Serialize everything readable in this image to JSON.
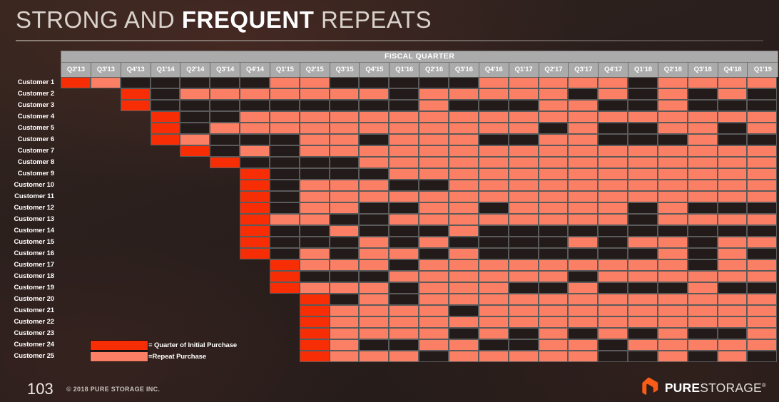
{
  "slide": {
    "title_part1": "STRONG AND ",
    "title_strong": "FREQUENT",
    "title_part2": " REPEATS",
    "page_number": "103",
    "copyright": "© 2018 PURE STORAGE INC.",
    "logo_name_bold": "PURE",
    "logo_name_light": "STORAGE",
    "logo_registered": "®"
  },
  "legend": {
    "items": [
      {
        "swatch": "initial",
        "label": "= Quarter of Initial Purchase",
        "color": "#F72D06"
      },
      {
        "swatch": "repeat",
        "label": "=Repeat Purchase",
        "color": "#FA7F65"
      }
    ]
  },
  "colors": {
    "initial_purchase": "#F72D06",
    "repeat_purchase": "#FA7F65",
    "no_purchase": "#231B19",
    "grid_line": "#5A5A5A",
    "header_band": "#ABABAB",
    "background": "#2B201E",
    "title_text": "#D9D2CC"
  },
  "chart_data": {
    "type": "heatmap",
    "title": "STRONG AND FREQUENT REPEATS",
    "xlabel": "FISCAL QUARTER",
    "ylabel": "",
    "axis_band_label": "FISCAL QUARTER",
    "legend_position": "bottom-left",
    "grid": true,
    "value_legend": {
      "0": "No purchase",
      "1": "Repeat Purchase",
      "2": "Quarter of Initial Purchase",
      "null": "Before customer acquisition"
    },
    "categories": [
      "Q2'13",
      "Q3'13",
      "Q4'13",
      "Q1'14",
      "Q2'14",
      "Q3'14",
      "Q4'14",
      "Q1'15",
      "Q2'15",
      "Q3'15",
      "Q4'15",
      "Q1'16",
      "Q2'16",
      "Q3'16",
      "Q4'16",
      "Q1'17",
      "Q2'17",
      "Q3'17",
      "Q4'17",
      "Q1'18",
      "Q2'18",
      "Q3'18",
      "Q4'18",
      "Q1'19"
    ],
    "rows": [
      "Customer 1",
      "Customer 2",
      "Customer 3",
      "Customer 4",
      "Customer 5",
      "Customer 6",
      "Customer 7",
      "Customer 8",
      "Customer 9",
      "Customer 10",
      "Customer 11",
      "Customer 12",
      "Customer 13",
      "Customer 14",
      "Customer 15",
      "Customer 16",
      "Customer 17",
      "Customer 18",
      "Customer 19",
      "Customer 20",
      "Customer 21",
      "Customer 22",
      "Customer 23",
      "Customer 24",
      "Customer 25"
    ],
    "series": [
      {
        "name": "Customer 1",
        "values": [
          2,
          1,
          0,
          0,
          0,
          0,
          0,
          1,
          1,
          0,
          0,
          0,
          0,
          0,
          1,
          1,
          1,
          1,
          1,
          0,
          1,
          1,
          1,
          1
        ]
      },
      {
        "name": "Customer 2",
        "values": [
          null,
          null,
          2,
          0,
          1,
          1,
          1,
          1,
          1,
          1,
          1,
          0,
          1,
          1,
          1,
          1,
          1,
          0,
          1,
          0,
          1,
          0,
          1,
          0
        ]
      },
      {
        "name": "Customer 3",
        "values": [
          null,
          null,
          2,
          0,
          0,
          0,
          0,
          0,
          0,
          0,
          0,
          0,
          1,
          0,
          0,
          0,
          1,
          1,
          0,
          0,
          1,
          0,
          0,
          0
        ]
      },
      {
        "name": "Customer 4",
        "values": [
          null,
          null,
          null,
          2,
          0,
          0,
          1,
          1,
          1,
          1,
          1,
          1,
          1,
          1,
          1,
          1,
          1,
          1,
          1,
          1,
          1,
          1,
          1,
          1
        ]
      },
      {
        "name": "Customer 5",
        "values": [
          null,
          null,
          null,
          2,
          0,
          1,
          1,
          1,
          1,
          1,
          1,
          1,
          1,
          1,
          1,
          1,
          0,
          1,
          0,
          0,
          1,
          1,
          0,
          1
        ]
      },
      {
        "name": "Customer 6",
        "values": [
          null,
          null,
          null,
          2,
          1,
          0,
          0,
          0,
          1,
          1,
          0,
          1,
          1,
          1,
          0,
          0,
          1,
          1,
          0,
          0,
          0,
          1,
          0,
          0
        ]
      },
      {
        "name": "Customer 7",
        "values": [
          null,
          null,
          null,
          null,
          2,
          0,
          1,
          0,
          1,
          1,
          1,
          1,
          1,
          1,
          1,
          1,
          1,
          1,
          1,
          1,
          1,
          1,
          1,
          1
        ]
      },
      {
        "name": "Customer 8",
        "values": [
          null,
          null,
          null,
          null,
          null,
          2,
          0,
          0,
          0,
          0,
          1,
          1,
          1,
          1,
          1,
          1,
          1,
          1,
          1,
          1,
          1,
          1,
          1,
          1
        ]
      },
      {
        "name": "Customer 9",
        "values": [
          null,
          null,
          null,
          null,
          null,
          null,
          2,
          0,
          0,
          0,
          0,
          1,
          1,
          1,
          1,
          1,
          1,
          1,
          1,
          1,
          1,
          1,
          1,
          1
        ]
      },
      {
        "name": "Customer 10",
        "values": [
          null,
          null,
          null,
          null,
          null,
          null,
          2,
          0,
          1,
          1,
          1,
          0,
          0,
          1,
          1,
          1,
          1,
          1,
          1,
          1,
          1,
          1,
          1,
          1
        ]
      },
      {
        "name": "Customer 11",
        "values": [
          null,
          null,
          null,
          null,
          null,
          null,
          2,
          0,
          1,
          1,
          1,
          1,
          1,
          1,
          1,
          1,
          1,
          1,
          1,
          1,
          1,
          1,
          1,
          1
        ]
      },
      {
        "name": "Customer 12",
        "values": [
          null,
          null,
          null,
          null,
          null,
          null,
          2,
          0,
          1,
          1,
          0,
          0,
          1,
          1,
          0,
          1,
          1,
          1,
          1,
          0,
          1,
          0,
          0,
          0
        ]
      },
      {
        "name": "Customer 13",
        "values": [
          null,
          null,
          null,
          null,
          null,
          null,
          2,
          1,
          1,
          0,
          0,
          1,
          1,
          1,
          1,
          1,
          1,
          1,
          1,
          0,
          1,
          1,
          1,
          1
        ]
      },
      {
        "name": "Customer 14",
        "values": [
          null,
          null,
          null,
          null,
          null,
          null,
          2,
          0,
          0,
          1,
          0,
          0,
          0,
          1,
          0,
          0,
          0,
          0,
          0,
          0,
          0,
          0,
          0,
          0
        ]
      },
      {
        "name": "Customer 15",
        "values": [
          null,
          null,
          null,
          null,
          null,
          null,
          2,
          0,
          0,
          0,
          1,
          0,
          1,
          0,
          0,
          0,
          0,
          1,
          0,
          1,
          1,
          0,
          1,
          1
        ]
      },
      {
        "name": "Customer 16",
        "values": [
          null,
          null,
          null,
          null,
          null,
          null,
          2,
          0,
          1,
          0,
          1,
          1,
          0,
          1,
          0,
          0,
          0,
          0,
          0,
          0,
          1,
          0,
          1,
          0
        ]
      },
      {
        "name": "Customer 17",
        "values": [
          null,
          null,
          null,
          null,
          null,
          null,
          null,
          2,
          1,
          1,
          1,
          0,
          1,
          1,
          1,
          1,
          1,
          1,
          1,
          1,
          1,
          0,
          1,
          1
        ]
      },
      {
        "name": "Customer 18",
        "values": [
          null,
          null,
          null,
          null,
          null,
          null,
          null,
          2,
          0,
          0,
          0,
          1,
          1,
          1,
          1,
          1,
          1,
          0,
          1,
          1,
          1,
          1,
          1,
          1
        ]
      },
      {
        "name": "Customer 19",
        "values": [
          null,
          null,
          null,
          null,
          null,
          null,
          null,
          2,
          1,
          1,
          1,
          0,
          1,
          1,
          1,
          0,
          0,
          1,
          0,
          0,
          0,
          1,
          0,
          0
        ]
      },
      {
        "name": "Customer 20",
        "values": [
          null,
          null,
          null,
          null,
          null,
          null,
          null,
          null,
          2,
          0,
          1,
          0,
          1,
          1,
          1,
          1,
          1,
          1,
          1,
          1,
          1,
          1,
          1,
          1
        ]
      },
      {
        "name": "Customer 21",
        "values": [
          null,
          null,
          null,
          null,
          null,
          null,
          null,
          null,
          2,
          1,
          1,
          1,
          1,
          0,
          1,
          1,
          1,
          1,
          1,
          1,
          1,
          1,
          1,
          1
        ]
      },
      {
        "name": "Customer 22",
        "values": [
          null,
          null,
          null,
          null,
          null,
          null,
          null,
          null,
          2,
          1,
          1,
          1,
          1,
          1,
          1,
          1,
          1,
          1,
          1,
          1,
          1,
          1,
          1,
          1
        ]
      },
      {
        "name": "Customer 23",
        "values": [
          null,
          null,
          null,
          null,
          null,
          null,
          null,
          null,
          2,
          1,
          1,
          1,
          1,
          0,
          1,
          0,
          1,
          0,
          1,
          0,
          1,
          0,
          0,
          1
        ]
      },
      {
        "name": "Customer 24",
        "values": [
          null,
          null,
          null,
          null,
          null,
          null,
          null,
          null,
          2,
          1,
          0,
          0,
          1,
          1,
          0,
          0,
          1,
          1,
          0,
          1,
          1,
          1,
          1,
          1
        ]
      },
      {
        "name": "Customer 25",
        "values": [
          null,
          null,
          null,
          null,
          null,
          null,
          null,
          null,
          2,
          1,
          1,
          1,
          0,
          1,
          1,
          1,
          1,
          1,
          0,
          0,
          1,
          0,
          1,
          0
        ]
      }
    ]
  }
}
